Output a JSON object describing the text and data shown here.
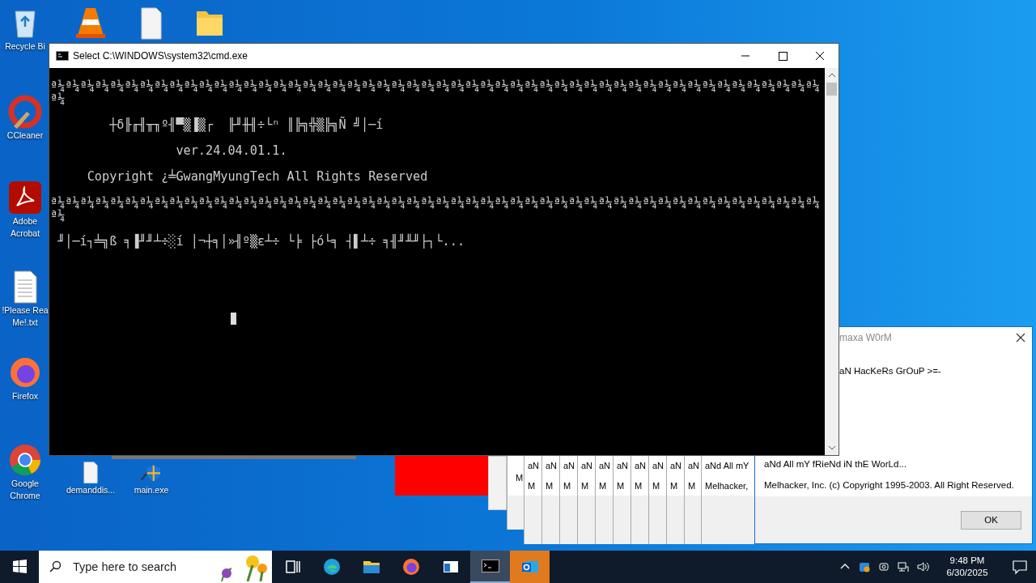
{
  "desktop_icons": [
    {
      "kind": "recycle",
      "lines": [
        "Recycle Bi"
      ]
    },
    {
      "kind": "cone"
    },
    {
      "kind": "file"
    },
    {
      "kind": "folder"
    },
    {
      "kind": "ccleaner",
      "lines": [
        "CCleaner"
      ]
    },
    {
      "kind": "pdf",
      "lines": [
        "Adobe",
        "Acrobat"
      ]
    },
    {
      "kind": "text",
      "lines": [
        "!Please Rea",
        "Me!.txt"
      ]
    },
    {
      "kind": "firefox",
      "lines": [
        "Firefox"
      ]
    },
    {
      "kind": "chrome",
      "lines": [
        "Google",
        "Chrome"
      ]
    },
    {
      "kind": "blank",
      "lines": [
        "demanddis..."
      ]
    },
    {
      "kind": "installer",
      "lines": [
        "main.exe"
      ]
    }
  ],
  "back_dialogs": [
    {
      "lines": [
        "M"
      ]
    },
    {
      "lines": [
        "aN",
        "M"
      ]
    },
    {
      "lines": [
        "aN",
        "M"
      ]
    },
    {
      "lines": [
        "aN",
        "M"
      ]
    },
    {
      "lines": [
        "aN",
        "M"
      ]
    },
    {
      "lines": [
        "aN",
        "M"
      ]
    },
    {
      "lines": [
        "aN",
        "M"
      ]
    },
    {
      "lines": [
        "aN",
        "M"
      ]
    },
    {
      "lines": [
        "aN",
        "M"
      ]
    },
    {
      "lines": [
        "aN",
        "M"
      ]
    },
    {
      "lines": [
        "aN",
        "M"
      ]
    },
    {
      "lines": [
        "aNd All mY",
        "Melhacker,"
      ]
    }
  ],
  "front_dialog": {
    "title": "maxa W0rM",
    "heading": "aN HacKeRs GrOuP >=-",
    "lines": [
      "aNd All mY fRieNd iN thE WorLd...",
      "Melhacker, Inc. (c) Copyright 1995-2003. All Right Reserved."
    ],
    "button": "OK"
  },
  "console_window": {
    "title": "Select C:\\WINDOWS\\system32\\cmd.exe",
    "lines": [
      "ª¼ª¼ª¼ª¼ª¼ª¼ª¼ª¼ª¼ª¼ª¼ª¼ª¼ª¼ª¼ª¼ª¼ª¼ª¼ª¼ª¼ª¼ª¼ª¼ª¼ª¼ª¼ª¼ª¼ª¼ª¼ª¼ª¼ª¼ª¼ª¼ª¼ª¼ª¼ª¼ª¼ª¼ª¼ª¼ª¼ª¼ª¼ª¼ª¼ª¼ª¼ª¼",
      "ª¼",
      "┼δ╟╓╢╥╖º╢▀▒▐▒┌  ╟╜╫╢÷└ⁿ ║╠╗╬▒╠╗Ñ ╝│─í",
      "ver.24.04.01.1.",
      "Copyright ¿╧GwangMyungTech All Rights Reserved",
      "ª¼ª¼ª¼ª¼ª¼ª¼ª¼ª¼ª¼ª¼ª¼ª¼ª¼ª¼ª¼ª¼ª¼ª¼ª¼ª¼ª¼ª¼ª¼ª¼ª¼ª¼ª¼ª¼ª¼ª¼ª¼ª¼ª¼ª¼ª¼ª¼ª¼ª¼ª¼ª¼ª¼ª¼ª¼ª¼ª¼ª¼ª¼ª¼ª¼ª¼ª¼ª¼",
      "ª¼",
      "╜│─í┐╧╗ß ╕▐╜╜┴÷░í │¬┼╕│»╢º▒ε┴÷ └╞ ├ó└╕ ┤▌┴÷ ╕╢╜╨╜├┐└..."
    ]
  },
  "taskbar": {
    "search": {
      "placeholder": "Type here to search"
    },
    "apps": [
      {
        "kind": "taskview",
        "selected": false,
        "flashing": false
      },
      {
        "kind": "edge",
        "selected": false,
        "flashing": false
      },
      {
        "kind": "explorer",
        "selected": false,
        "flashing": false
      },
      {
        "kind": "firefox",
        "selected": false,
        "flashing": false
      },
      {
        "kind": "window",
        "selected": false,
        "flashing": false
      },
      {
        "kind": "console",
        "selected": true,
        "flashing": false
      },
      {
        "kind": "mail",
        "selected": false,
        "flashing": true
      }
    ],
    "time": "9:48 PM",
    "date": "6/30/2025"
  }
}
